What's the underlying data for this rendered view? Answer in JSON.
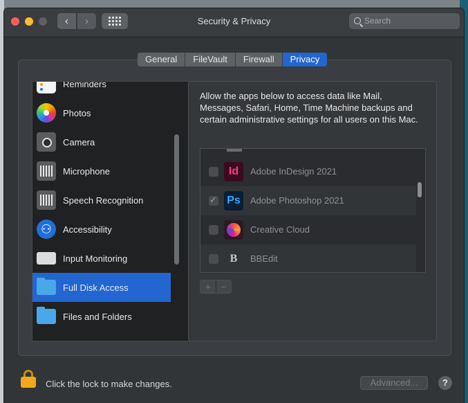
{
  "window": {
    "title": "Security & Privacy"
  },
  "toolbar": {
    "back_icon": "‹",
    "forward_icon": "›",
    "search_placeholder": "Search"
  },
  "tabs": [
    {
      "label": "General",
      "active": false
    },
    {
      "label": "FileVault",
      "active": false
    },
    {
      "label": "Firewall",
      "active": false
    },
    {
      "label": "Privacy",
      "active": true
    }
  ],
  "sidebar": {
    "items": [
      {
        "label": "Reminders",
        "icon": "reminders-icon"
      },
      {
        "label": "Photos",
        "icon": "photos-icon"
      },
      {
        "label": "Camera",
        "icon": "camera-icon"
      },
      {
        "label": "Microphone",
        "icon": "microphone-icon"
      },
      {
        "label": "Speech Recognition",
        "icon": "speech-recognition-icon"
      },
      {
        "label": "Accessibility",
        "icon": "accessibility-icon"
      },
      {
        "label": "Input Monitoring",
        "icon": "keyboard-icon"
      },
      {
        "label": "Full Disk Access",
        "icon": "folder-icon",
        "selected": true
      },
      {
        "label": "Files and Folders",
        "icon": "folder-icon"
      }
    ]
  },
  "detail": {
    "description": "Allow the apps below to access data like Mail, Messages, Safari, Home, Time Machine backups and certain administrative settings for all users on this Mac.",
    "apps": [
      {
        "name": "Adobe InDesign 2021",
        "icon_text": "Id",
        "checked": false
      },
      {
        "name": "Adobe Photoshop 2021",
        "icon_text": "Ps",
        "checked": true
      },
      {
        "name": "Creative Cloud",
        "icon_text": "",
        "checked": false
      },
      {
        "name": "BBEdit",
        "icon_text": "B",
        "checked": false
      }
    ],
    "add_label": "+",
    "remove_label": "−"
  },
  "footer": {
    "lock_text": "Click the lock to make changes.",
    "advanced_label": "Advanced...",
    "help_label": "?"
  },
  "colors": {
    "accent": "#2366d1",
    "lock": "#f0a91c"
  }
}
